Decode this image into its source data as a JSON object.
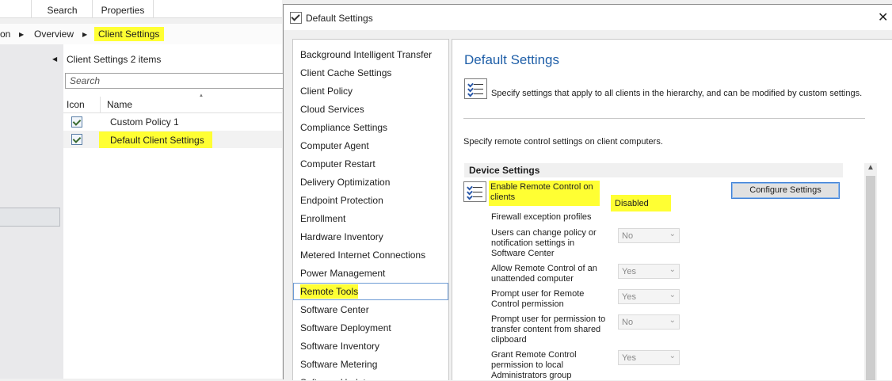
{
  "background": {
    "ribbon_tabs": [
      "Search",
      "Properties"
    ],
    "breadcrumb": [
      "on",
      "Overview",
      "Client Settings"
    ],
    "list_title": "Client Settings 2 items",
    "search_placeholder": "Search",
    "columns": [
      "Icon",
      "Name"
    ],
    "rows": [
      {
        "name": "Custom Policy 1"
      },
      {
        "name": "Default Client Settings"
      }
    ]
  },
  "dialog": {
    "title": "Default Settings",
    "close_glyph": "✕",
    "nav_items": [
      "Background Intelligent Transfer",
      "Client Cache Settings",
      "Client Policy",
      "Cloud Services",
      "Compliance Settings",
      "Computer Agent",
      "Computer Restart",
      "Delivery Optimization",
      "Endpoint Protection",
      "Enrollment",
      "Hardware Inventory",
      "Metered Internet Connections",
      "Power Management",
      "Remote Tools",
      "Software Center",
      "Software Deployment",
      "Software Inventory",
      "Software Metering",
      "Software Updates"
    ],
    "selected_nav": "Remote Tools",
    "heading": "Default Settings",
    "description": "Specify settings that apply to all clients in the hierarchy, and can be modified by custom settings.",
    "subheading": "Specify remote control settings on client computers.",
    "section_title": "Device Settings",
    "enable_label": "Enable Remote Control on clients",
    "enable_value": "Disabled",
    "configure_button": "Configure Settings",
    "firewall_label": "Firewall exception profiles",
    "settings": [
      {
        "label": "Users can change policy or notification settings in Software Center",
        "value": "No"
      },
      {
        "label": "Allow Remote Control of an unattended computer",
        "value": "Yes"
      },
      {
        "label": "Prompt user for Remote Control permission",
        "value": "Yes"
      },
      {
        "label": "Prompt user for permission to transfer content from shared clipboard",
        "value": "No"
      },
      {
        "label": "Grant Remote Control permission to local Administrators group",
        "value": "Yes"
      }
    ],
    "colors": {
      "heading": "#1f5fa8",
      "highlight": "#ffff33",
      "focus_border": "#3c7fd6"
    }
  }
}
